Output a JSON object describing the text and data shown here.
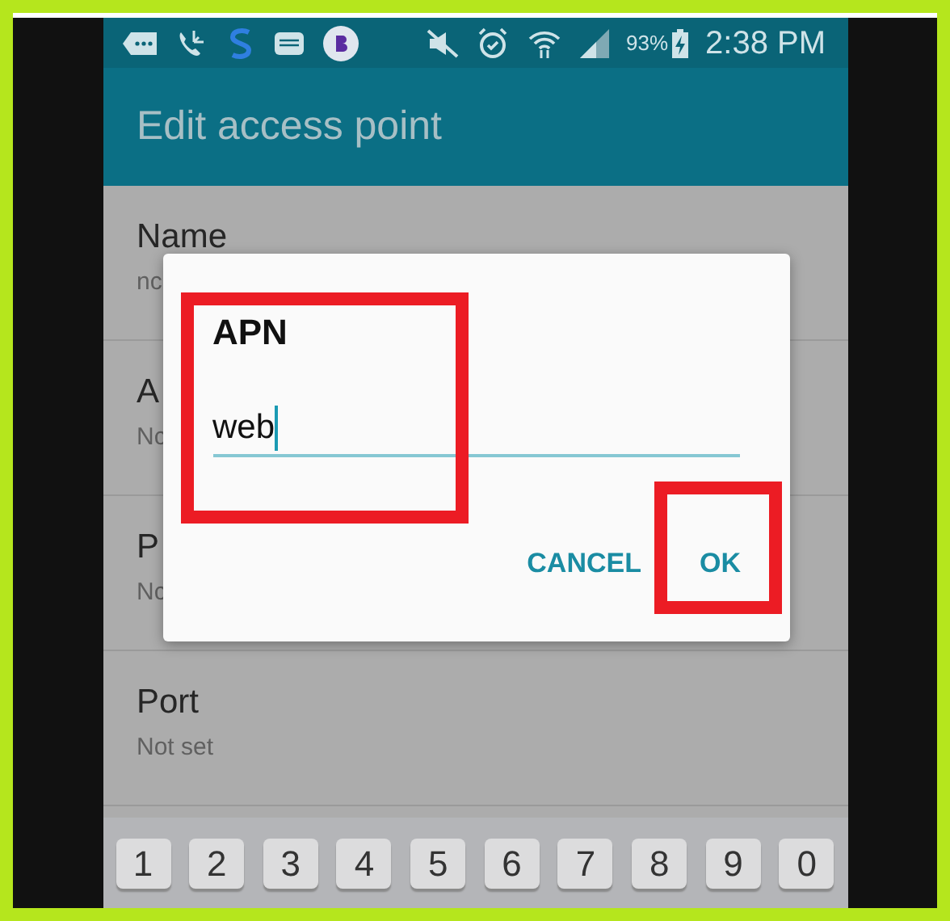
{
  "status_bar": {
    "battery": "93%",
    "time": "2:38 PM"
  },
  "app_bar": {
    "title": "Edit access point"
  },
  "settings": [
    {
      "title": "Name",
      "value": "nc"
    },
    {
      "title": "A",
      "value": "Nc"
    },
    {
      "title": "P",
      "value": "Nc"
    },
    {
      "title": "Port",
      "value": "Not set"
    }
  ],
  "dialog": {
    "title": "APN",
    "field_value": "web",
    "buttons": [
      {
        "label": "CANCEL"
      },
      {
        "label": "OK"
      }
    ]
  },
  "keyboard": {
    "keys": [
      "1",
      "2",
      "3",
      "4",
      "5",
      "6",
      "7",
      "8",
      "9",
      "0"
    ]
  }
}
